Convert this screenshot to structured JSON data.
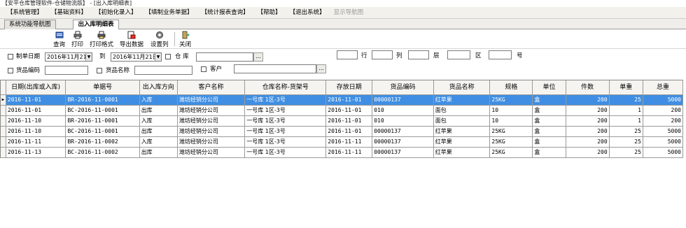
{
  "window": {
    "title": "【安平仓库管理软件-仓储物流版】 - [出入库明细表]"
  },
  "menu": [
    {
      "label": "【系统管理】",
      "enabled": true
    },
    {
      "label": "【基础资料】",
      "enabled": true
    },
    {
      "label": "【初始化录入】",
      "enabled": true
    },
    {
      "label": "【填制业务单据】",
      "enabled": true
    },
    {
      "label": "【统计报表查询】",
      "enabled": true
    },
    {
      "label": "【帮助】",
      "enabled": true
    },
    {
      "label": "【退出系统】",
      "enabled": true
    },
    {
      "label": "显示导航图",
      "enabled": false
    }
  ],
  "tabs": [
    {
      "label": "系统功能导航图",
      "active": false
    },
    {
      "label": "出入库明细表",
      "active": true
    }
  ],
  "toolbar": {
    "query": "查询",
    "print": "打印",
    "print_format": "打印格式",
    "export": "导出数据",
    "set_columns": "设置列",
    "close": "关闭"
  },
  "filters": {
    "make_date_label": "制单日期",
    "date_from": "2016年11月21日",
    "to_label": "到",
    "date_to": "2016年11月21日",
    "warehouse_label": "仓  库",
    "warehouse_value": "",
    "row_label": "行",
    "col_label": "列",
    "layer_label": "层",
    "area_label": "区",
    "num_label": "号",
    "goods_code_label": "货品编码",
    "goods_name_label": "货品名称",
    "customer_label": "客户",
    "ellipsis": "..."
  },
  "table": {
    "columns": [
      "日期(出库或入库)",
      "单据号",
      "出入库方向",
      "客户名称",
      "仓库名称-货架号",
      "存放日期",
      "货品编码",
      "货品名称",
      "规格",
      "单位",
      "件数",
      "单重",
      "总重"
    ],
    "rows": [
      [
        "2016-11-01",
        "BR-2016-11-0001",
        "入库",
        "潍坊经销分公司",
        "一号库    1区-3号",
        "2016-11-01",
        "00000137",
        "红苹果",
        "25KG",
        "盒",
        "200",
        "25",
        "5000"
      ],
      [
        "2016-11-01",
        "BC-2016-11-0001",
        "出库",
        "潍坊经销分公司",
        "一号库    1区-3号",
        "2016-11-01",
        "010",
        "面包",
        "10",
        "盒",
        "200",
        "1",
        "200"
      ],
      [
        "2016-11-10",
        "BR-2016-11-0001",
        "入库",
        "潍坊经销分公司",
        "一号库    1区-3号",
        "2016-11-01",
        "010",
        "面包",
        "10",
        "盒",
        "200",
        "1",
        "200"
      ],
      [
        "2016-11-10",
        "BC-2016-11-0001",
        "出库",
        "潍坊经销分公司",
        "一号库    1区-3号",
        "2016-11-01",
        "00000137",
        "红苹果",
        "25KG",
        "盒",
        "200",
        "25",
        "5000"
      ],
      [
        "2016-11-11",
        "BR-2016-11-0002",
        "入库",
        "潍坊经销分公司",
        "一号库    1区-3号",
        "2016-11-11",
        "00000137",
        "红苹果",
        "25KG",
        "盒",
        "200",
        "25",
        "5000"
      ],
      [
        "2016-11-13",
        "BC-2016-11-0002",
        "出库",
        "潍坊经销分公司",
        "一号库    1区-3号",
        "2016-11-11",
        "00000137",
        "红苹果",
        "25KG",
        "盒",
        "200",
        "25",
        "5000"
      ]
    ],
    "selected_row": 0
  },
  "colors": {
    "selection": "#3f8ee3",
    "menubar": "#f2f1ec"
  }
}
